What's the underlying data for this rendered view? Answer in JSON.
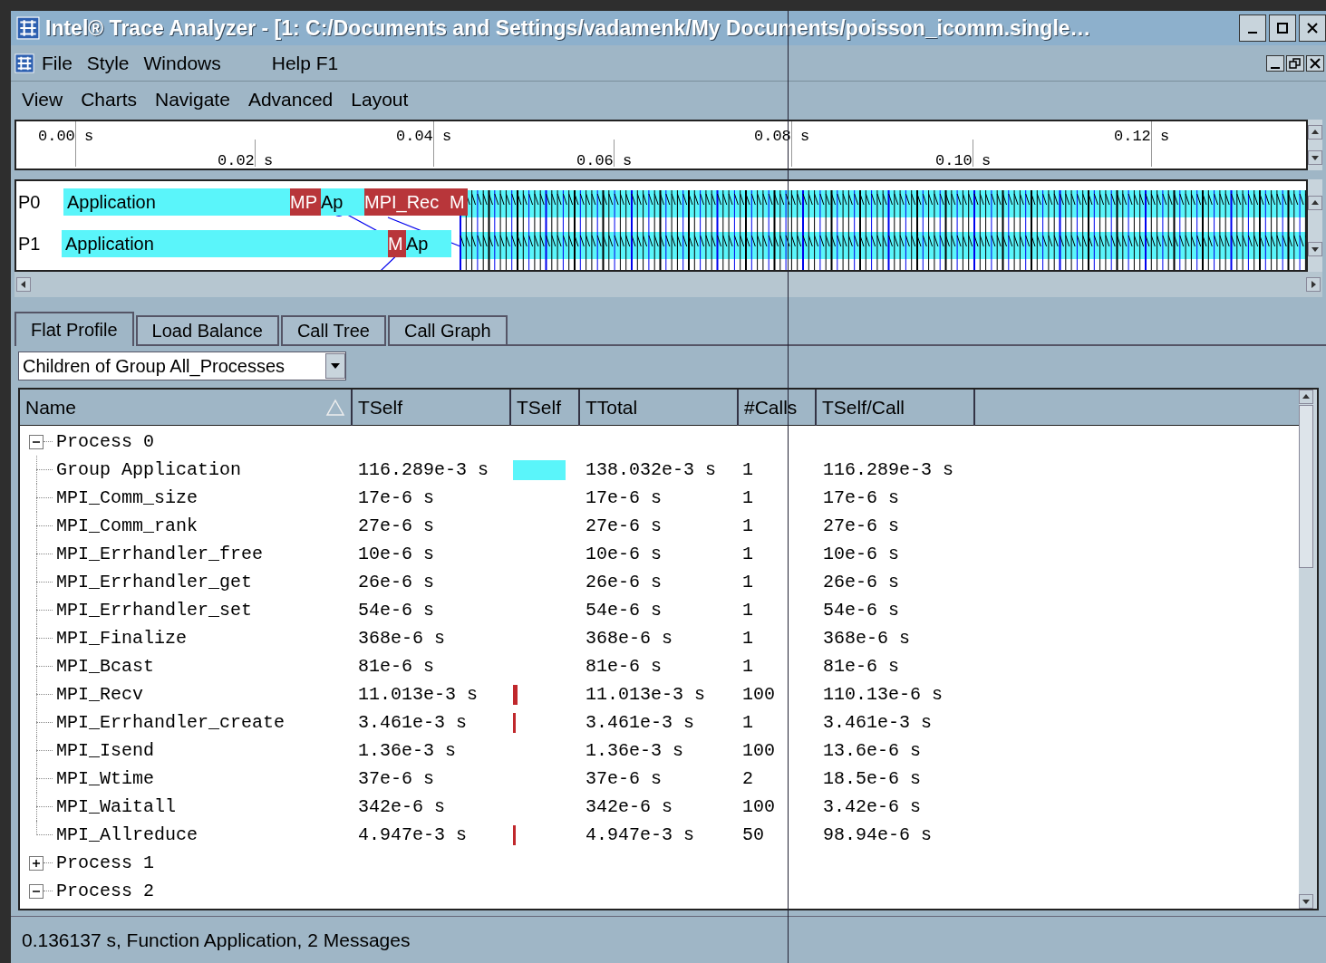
{
  "window": {
    "title": "Intel® Trace Analyzer - [1: C:/Documents and Settings/vadamenk/My Documents/poisson_icomm.single…"
  },
  "menu_bar": [
    "File",
    "Style",
    "Windows",
    "Help F1"
  ],
  "view_menu": [
    "View",
    "Charts",
    "Navigate",
    "Advanced",
    "Layout"
  ],
  "ruler": {
    "labels": [
      {
        "text": "0.00 s",
        "kind": "upper"
      },
      {
        "text": "0.02 s",
        "kind": "lower"
      },
      {
        "text": "0.04 s",
        "kind": "upper"
      },
      {
        "text": "0.06 s",
        "kind": "lower"
      },
      {
        "text": "0.08 s",
        "kind": "upper"
      },
      {
        "text": "0.10 s",
        "kind": "lower"
      },
      {
        "text": "0.12 s",
        "kind": "upper"
      }
    ]
  },
  "timeline": {
    "rows": [
      {
        "process": "P0",
        "segments": [
          {
            "text": "Application",
            "kind": "app"
          },
          {
            "text": "MP",
            "kind": "mpi"
          },
          {
            "text": "Ap",
            "kind": "app"
          },
          {
            "text": "MPI_Rec",
            "kind": "mpi"
          },
          {
            "text": "M",
            "kind": "mpi"
          }
        ]
      },
      {
        "process": "P1",
        "segments": [
          {
            "text": "Application",
            "kind": "app"
          },
          {
            "text": "M",
            "kind": "mpi"
          },
          {
            "text": "Ap",
            "kind": "app"
          }
        ]
      }
    ]
  },
  "tabs": [
    {
      "label": "Flat Profile",
      "selected": true
    },
    {
      "label": "Load Balance",
      "selected": false
    },
    {
      "label": "Call Tree",
      "selected": false
    },
    {
      "label": "Call Graph",
      "selected": false
    }
  ],
  "filter": {
    "value": "Children of Group All_Processes"
  },
  "table": {
    "columns": [
      {
        "label": "Name",
        "sorted": true
      },
      {
        "label": "TSelf",
        "sorted": false
      },
      {
        "label": "TSelf",
        "sorted": false
      },
      {
        "label": "TTotal",
        "sorted": false
      },
      {
        "label": "#Calls",
        "sorted": false
      },
      {
        "label": "TSelf/Call",
        "sorted": false
      }
    ],
    "rows": [
      {
        "name": "Process 0",
        "expanded": true,
        "children": [
          {
            "name": "Group Application",
            "tself": "116.289e-3 s",
            "color": "#5af5fa",
            "ttotal": "138.032e-3 s",
            "calls": "1",
            "tself_call": "116.289e-3 s"
          },
          {
            "name": "MPI_Comm_size",
            "tself": "17e-6 s",
            "ttotal": "17e-6 s",
            "calls": "1",
            "tself_call": "17e-6 s"
          },
          {
            "name": "MPI_Comm_rank",
            "tself": "27e-6 s",
            "ttotal": "27e-6 s",
            "calls": "1",
            "tself_call": "27e-6 s"
          },
          {
            "name": "MPI_Errhandler_free",
            "tself": "10e-6 s",
            "ttotal": "10e-6 s",
            "calls": "1",
            "tself_call": "10e-6 s"
          },
          {
            "name": "MPI_Errhandler_get",
            "tself": "26e-6 s",
            "ttotal": "26e-6 s",
            "calls": "1",
            "tself_call": "26e-6 s"
          },
          {
            "name": "MPI_Errhandler_set",
            "tself": "54e-6 s",
            "ttotal": "54e-6 s",
            "calls": "1",
            "tself_call": "54e-6 s"
          },
          {
            "name": "MPI_Finalize",
            "tself": "368e-6 s",
            "ttotal": "368e-6 s",
            "calls": "1",
            "tself_call": "368e-6 s"
          },
          {
            "name": "MPI_Bcast",
            "tself": "81e-6 s",
            "ttotal": "81e-6 s",
            "calls": "1",
            "tself_call": "81e-6 s"
          },
          {
            "name": "MPI_Recv",
            "tself": "11.013e-3 s",
            "color": "#c0282c",
            "ttotal": "11.013e-3 s",
            "calls": "100",
            "tself_call": "110.13e-6 s"
          },
          {
            "name": "MPI_Errhandler_create",
            "tself": "3.461e-3 s",
            "color": "#c0282c",
            "ttotal": "3.461e-3 s",
            "calls": "1",
            "tself_call": "3.461e-3 s"
          },
          {
            "name": "MPI_Isend",
            "tself": "1.36e-3 s",
            "ttotal": "1.36e-3 s",
            "calls": "100",
            "tself_call": "13.6e-6 s"
          },
          {
            "name": "MPI_Wtime",
            "tself": "37e-6 s",
            "ttotal": "37e-6 s",
            "calls": "2",
            "tself_call": "18.5e-6 s"
          },
          {
            "name": "MPI_Waitall",
            "tself": "342e-6 s",
            "ttotal": "342e-6 s",
            "calls": "100",
            "tself_call": "3.42e-6 s"
          },
          {
            "name": "MPI_Allreduce",
            "tself": "4.947e-3 s",
            "color": "#c0282c",
            "ttotal": "4.947e-3 s",
            "calls": "50",
            "tself_call": "98.94e-6 s"
          }
        ]
      },
      {
        "name": "Process 1",
        "expanded": false,
        "children": []
      },
      {
        "name": "Process 2",
        "expanded": true,
        "children": []
      }
    ]
  },
  "status_bar": {
    "text": "0.136137 s, Function Application, 2 Messages"
  }
}
